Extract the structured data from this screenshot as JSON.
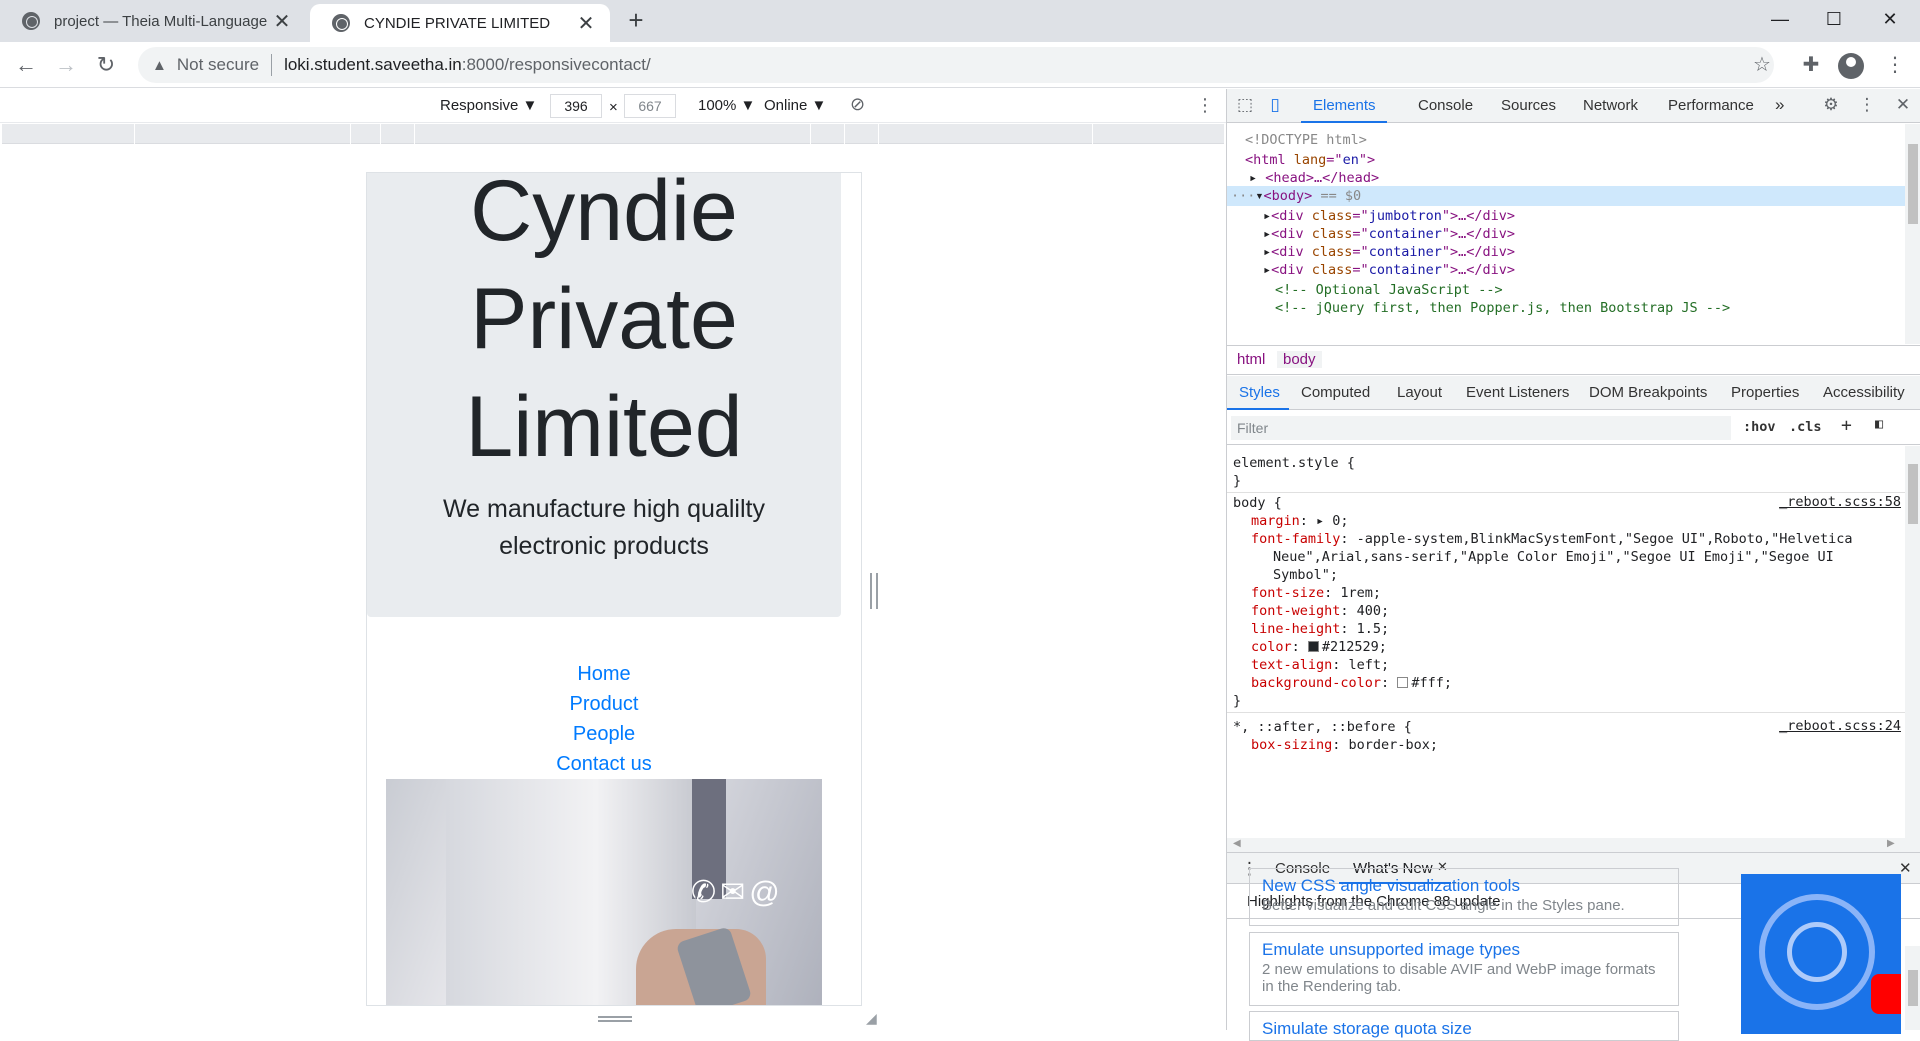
{
  "browser": {
    "tabs": [
      {
        "title": "project — Theia Multi-Language",
        "close": "✕"
      },
      {
        "title": "CYNDIE PRIVATE LIMITED",
        "close": "✕"
      }
    ],
    "new_tab": "+",
    "window_controls": {
      "minimize": "—",
      "maximize": "☐",
      "close": "✕"
    },
    "address": {
      "security_label": "Not secure",
      "host": "loki.student.saveetha.in",
      "path": ":8000/responsivecontact/"
    }
  },
  "device_toolbar": {
    "mode": "Responsive ▼",
    "width": "396",
    "times": "×",
    "height": "667",
    "zoom": "100% ▼",
    "network": "Online ▼"
  },
  "page": {
    "jumbotron": {
      "title": "Cyndie Private Limited",
      "lead": "We manufacture high qualilty electronic products"
    },
    "nav": [
      "Home",
      "Product",
      "People",
      "Contact us"
    ]
  },
  "devtools": {
    "tabs": [
      "Elements",
      "Console",
      "Sources",
      "Network",
      "Performance"
    ],
    "more": "»",
    "dom": {
      "doctype": "<!DOCTYPE html>",
      "html_open": [
        "<html ",
        "lang",
        "=\"",
        "en",
        "\">"
      ],
      "head": "<head>…</head>",
      "body": [
        "<body>",
        " == $0"
      ],
      "divs": [
        "jumbotron",
        "container",
        "container",
        "container"
      ],
      "comment1": "<!-- Optional JavaScript -->",
      "comment2": "<!-- jQuery first, then Popper.js, then Bootstrap JS -->"
    },
    "breadcrumbs": [
      "html",
      "body"
    ],
    "subtabs": [
      "Styles",
      "Computed",
      "Layout",
      "Event Listeners",
      "DOM Breakpoints",
      "Properties",
      "Accessibility"
    ],
    "filter": {
      "placeholder": "Filter",
      "hov": ":hov",
      "cls": ".cls",
      "plus": "+"
    },
    "styles": {
      "element_style": "element.style {",
      "close": "}",
      "body_selector": "body {",
      "body_source": "_reboot.scss:58",
      "body_props": [
        {
          "name": "margin",
          "value": "▸ 0;"
        },
        {
          "name": "font-family",
          "value": "-apple-system,BlinkMacSystemFont,\"Segoe UI\",Roboto,\"Helvetica"
        },
        {
          "name": "",
          "value": "Neue\",Arial,sans-serif,\"Apple Color Emoji\",\"Segoe UI Emoji\",\"Segoe UI"
        },
        {
          "name": "",
          "value": "Symbol\";"
        },
        {
          "name": "font-size",
          "value": "1rem;"
        },
        {
          "name": "font-weight",
          "value": "400;"
        },
        {
          "name": "line-height",
          "value": "1.5;"
        },
        {
          "name": "color",
          "value": "#212529;"
        },
        {
          "name": "text-align",
          "value": "left;"
        },
        {
          "name": "background-color",
          "value": "#fff;"
        }
      ],
      "universal_selector": "*, ::after, ::before {",
      "universal_source": "_reboot.scss:24",
      "universal_prop": {
        "name": "box-sizing",
        "value": "border-box;"
      }
    },
    "drawer": {
      "tabs": [
        "Console",
        "What's New"
      ],
      "headline": "Highlights from the Chrome 88 update",
      "cards": [
        {
          "title": "New CSS angle visualization tools",
          "desc": "Better visualize and edit CSS angle in the Styles pane."
        },
        {
          "title": "Emulate unsupported image types",
          "desc": "2 new emulations to disable AVIF and WebP image formats in the Rendering tab."
        },
        {
          "title": "Simulate storage quota size",
          "desc": ""
        }
      ]
    }
  },
  "colors": {
    "accent": "#1a73e8",
    "link": "#007bff",
    "jumbotron": "#e9ecef",
    "swatch_color": "#212529",
    "swatch_bg": "#ffffff"
  }
}
